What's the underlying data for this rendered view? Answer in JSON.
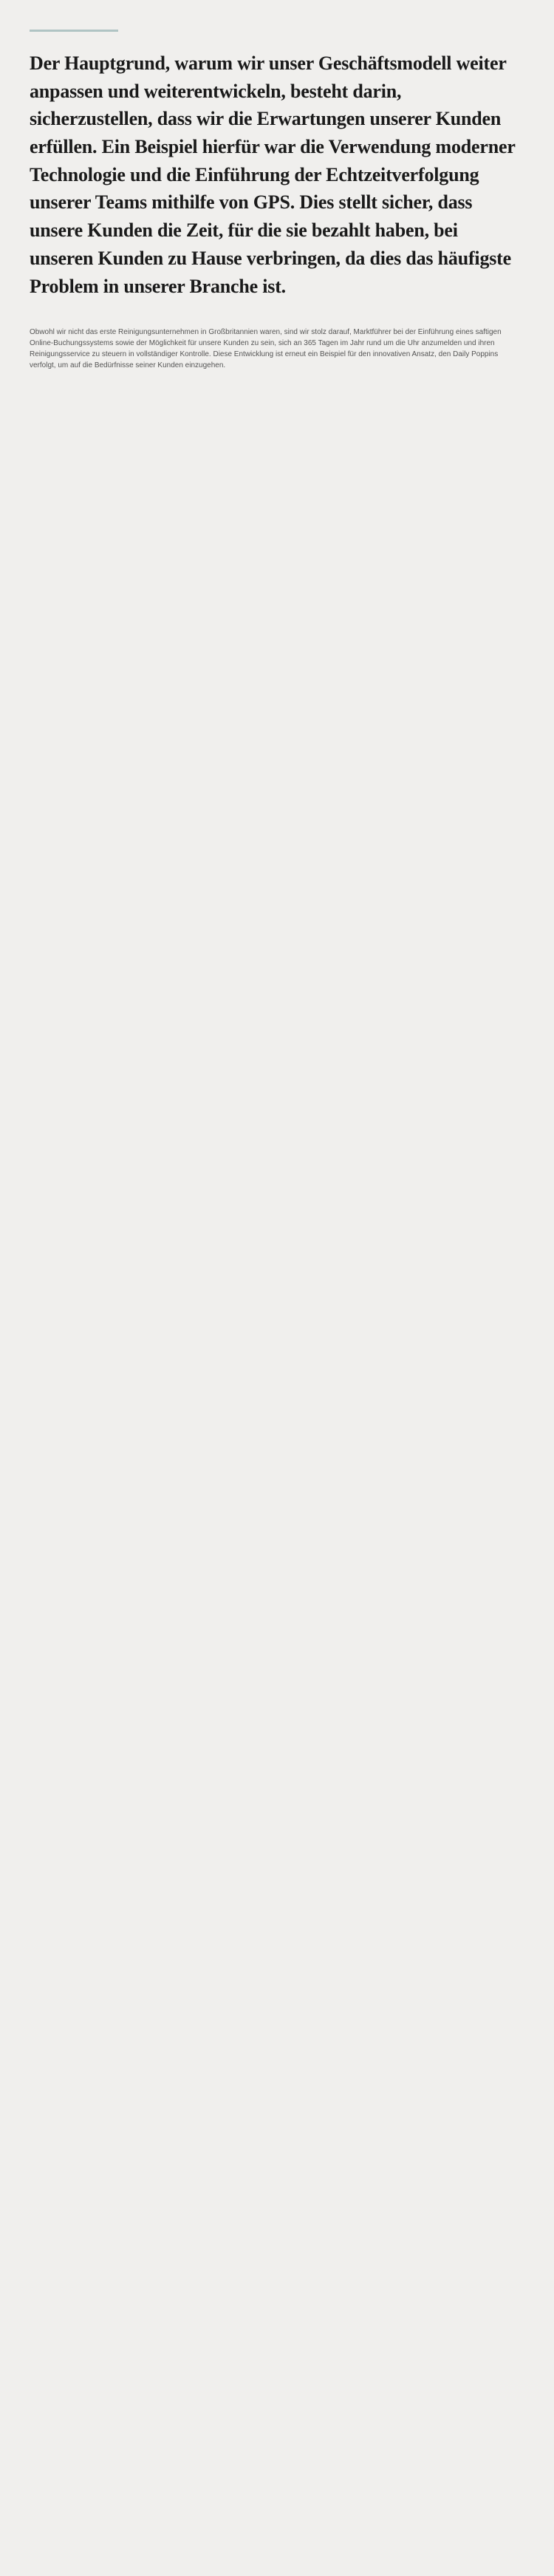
{
  "page": {
    "top_border_visible": true,
    "main_paragraph": "Der Hauptgrund, warum wir unser Geschäftsmodell weiter anpassen und weiterentwickeln, besteht darin, sicherzustellen, dass wir die Erwartungen unserer Kunden erfüllen. Ein Beispiel hierfür war die Verwendung moderner Technologie und die Einführung der Echtzeitverfolgung unserer Teams mithilfe von GPS. Dies stellt sicher, dass unsere Kunden die Zeit, für die sie bezahlt haben, bei unseren Kunden zu Hause verbringen, da dies das häufigste Problem in unserer Branche ist.",
    "small_paragraph": "Obwohl wir nicht das erste Reinigungsunternehmen in Großbritannien waren, sind wir stolz darauf, Marktführer bei der Einführung eines saftigen Online-Buchungssystems sowie der Möglichkeit für unsere Kunden zu sein, sich an 365 Tagen im Jahr rund um die Uhr anzumelden und ihren Reinigungsservice zu steuern in vollständiger Kontrolle. Diese Entwicklung ist erneut ein Beispiel für den innovativen Ansatz, den Daily Poppins verfolgt, um auf die Bedürfnisse seiner Kunden einzugehen."
  }
}
